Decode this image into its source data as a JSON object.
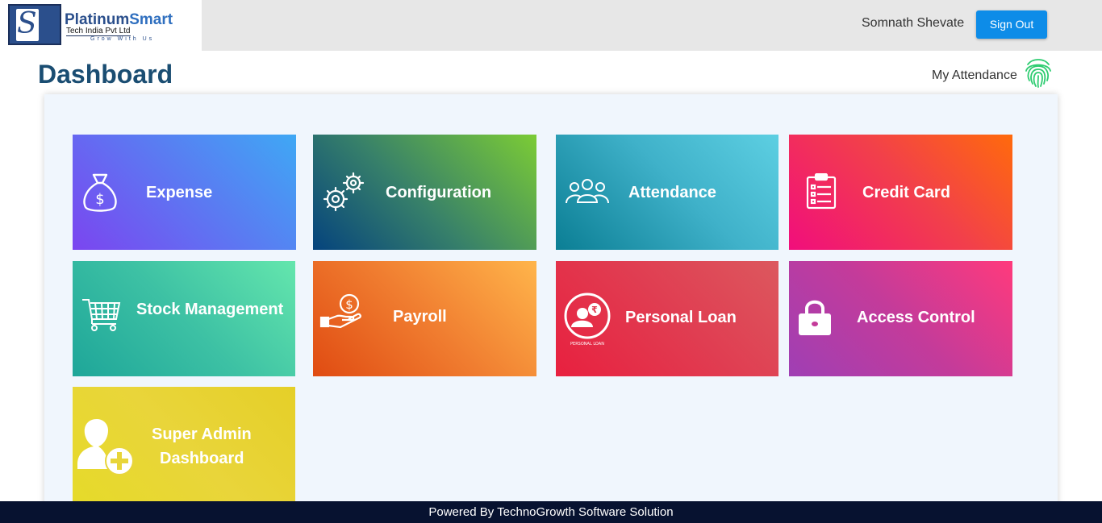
{
  "header": {
    "logo": {
      "brand_part1": "Platinum",
      "brand_part2": "Smart",
      "subtitle": "Tech India Pvt Ltd",
      "tagline": "Grow With Us"
    },
    "user_name": "Somnath Shevate",
    "sign_out_label": "Sign Out"
  },
  "page": {
    "title": "Dashboard",
    "attendance_link": "My Attendance"
  },
  "tiles": [
    {
      "label": "Expense",
      "icon": "money-bag-icon"
    },
    {
      "label": "Configuration",
      "icon": "gears-icon"
    },
    {
      "label": "Attendance",
      "icon": "people-group-icon"
    },
    {
      "label": "Credit Card",
      "icon": "clipboard-list-icon"
    },
    {
      "label": "Stock Management",
      "icon": "shopping-cart-icon"
    },
    {
      "label": "Payroll",
      "icon": "hand-coin-icon"
    },
    {
      "label": "Personal Loan",
      "icon": "personal-loan-icon",
      "icon_caption": "PERSONAL LOAN"
    },
    {
      "label": "Access Control",
      "icon": "padlock-icon"
    },
    {
      "label_line1": "Super Admin",
      "label_line2": "Dashboard",
      "icon": "add-user-icon"
    }
  ],
  "footer": {
    "text": "Powered By TechnoGrowth Software Solution"
  },
  "colors": {
    "header_bg": "#e7e7e7",
    "sign_out": "#0d8ce8",
    "title": "#1a4d72",
    "panel_bg": "#f0f6fd",
    "footer_bg": "#071230",
    "fingerprint": "#2ecc71"
  }
}
